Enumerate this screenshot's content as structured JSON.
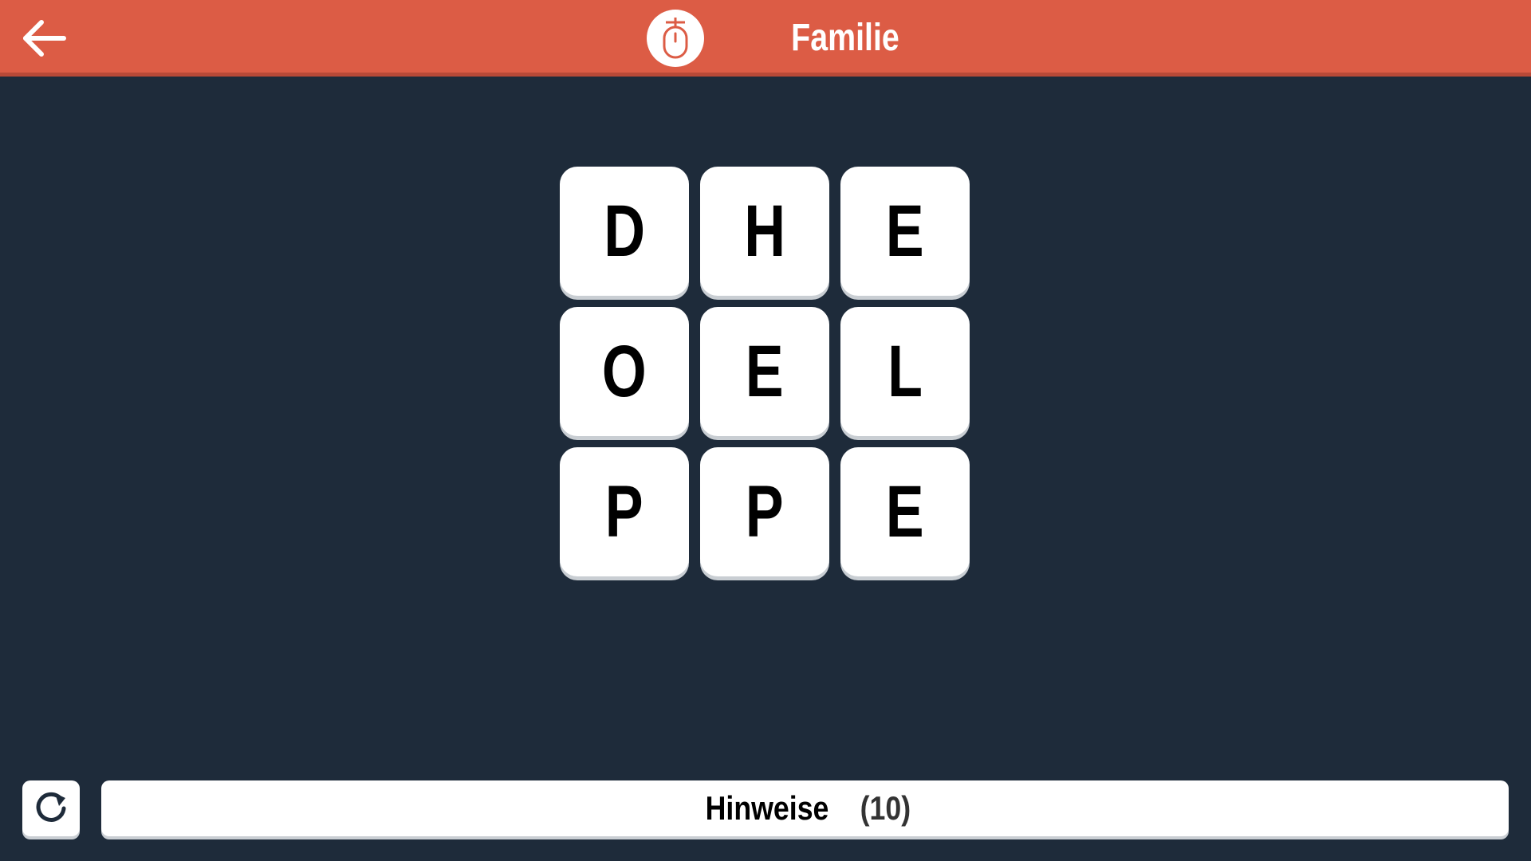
{
  "header": {
    "title": "Familie",
    "background": "#dc5c45",
    "back_icon": "arrow-left-icon",
    "category_icon": "baby-rattle-icon"
  },
  "grid": {
    "rows": [
      [
        "D",
        "H",
        "E"
      ],
      [
        "O",
        "E",
        "L"
      ],
      [
        "P",
        "P",
        "E"
      ]
    ]
  },
  "footer": {
    "refresh_icon": "refresh-icon",
    "hint_label": "Hinweise",
    "hint_count": "(10)"
  },
  "colors": {
    "background": "#1e2b3a",
    "tile": "#ffffff",
    "accent": "#dc5c45"
  }
}
